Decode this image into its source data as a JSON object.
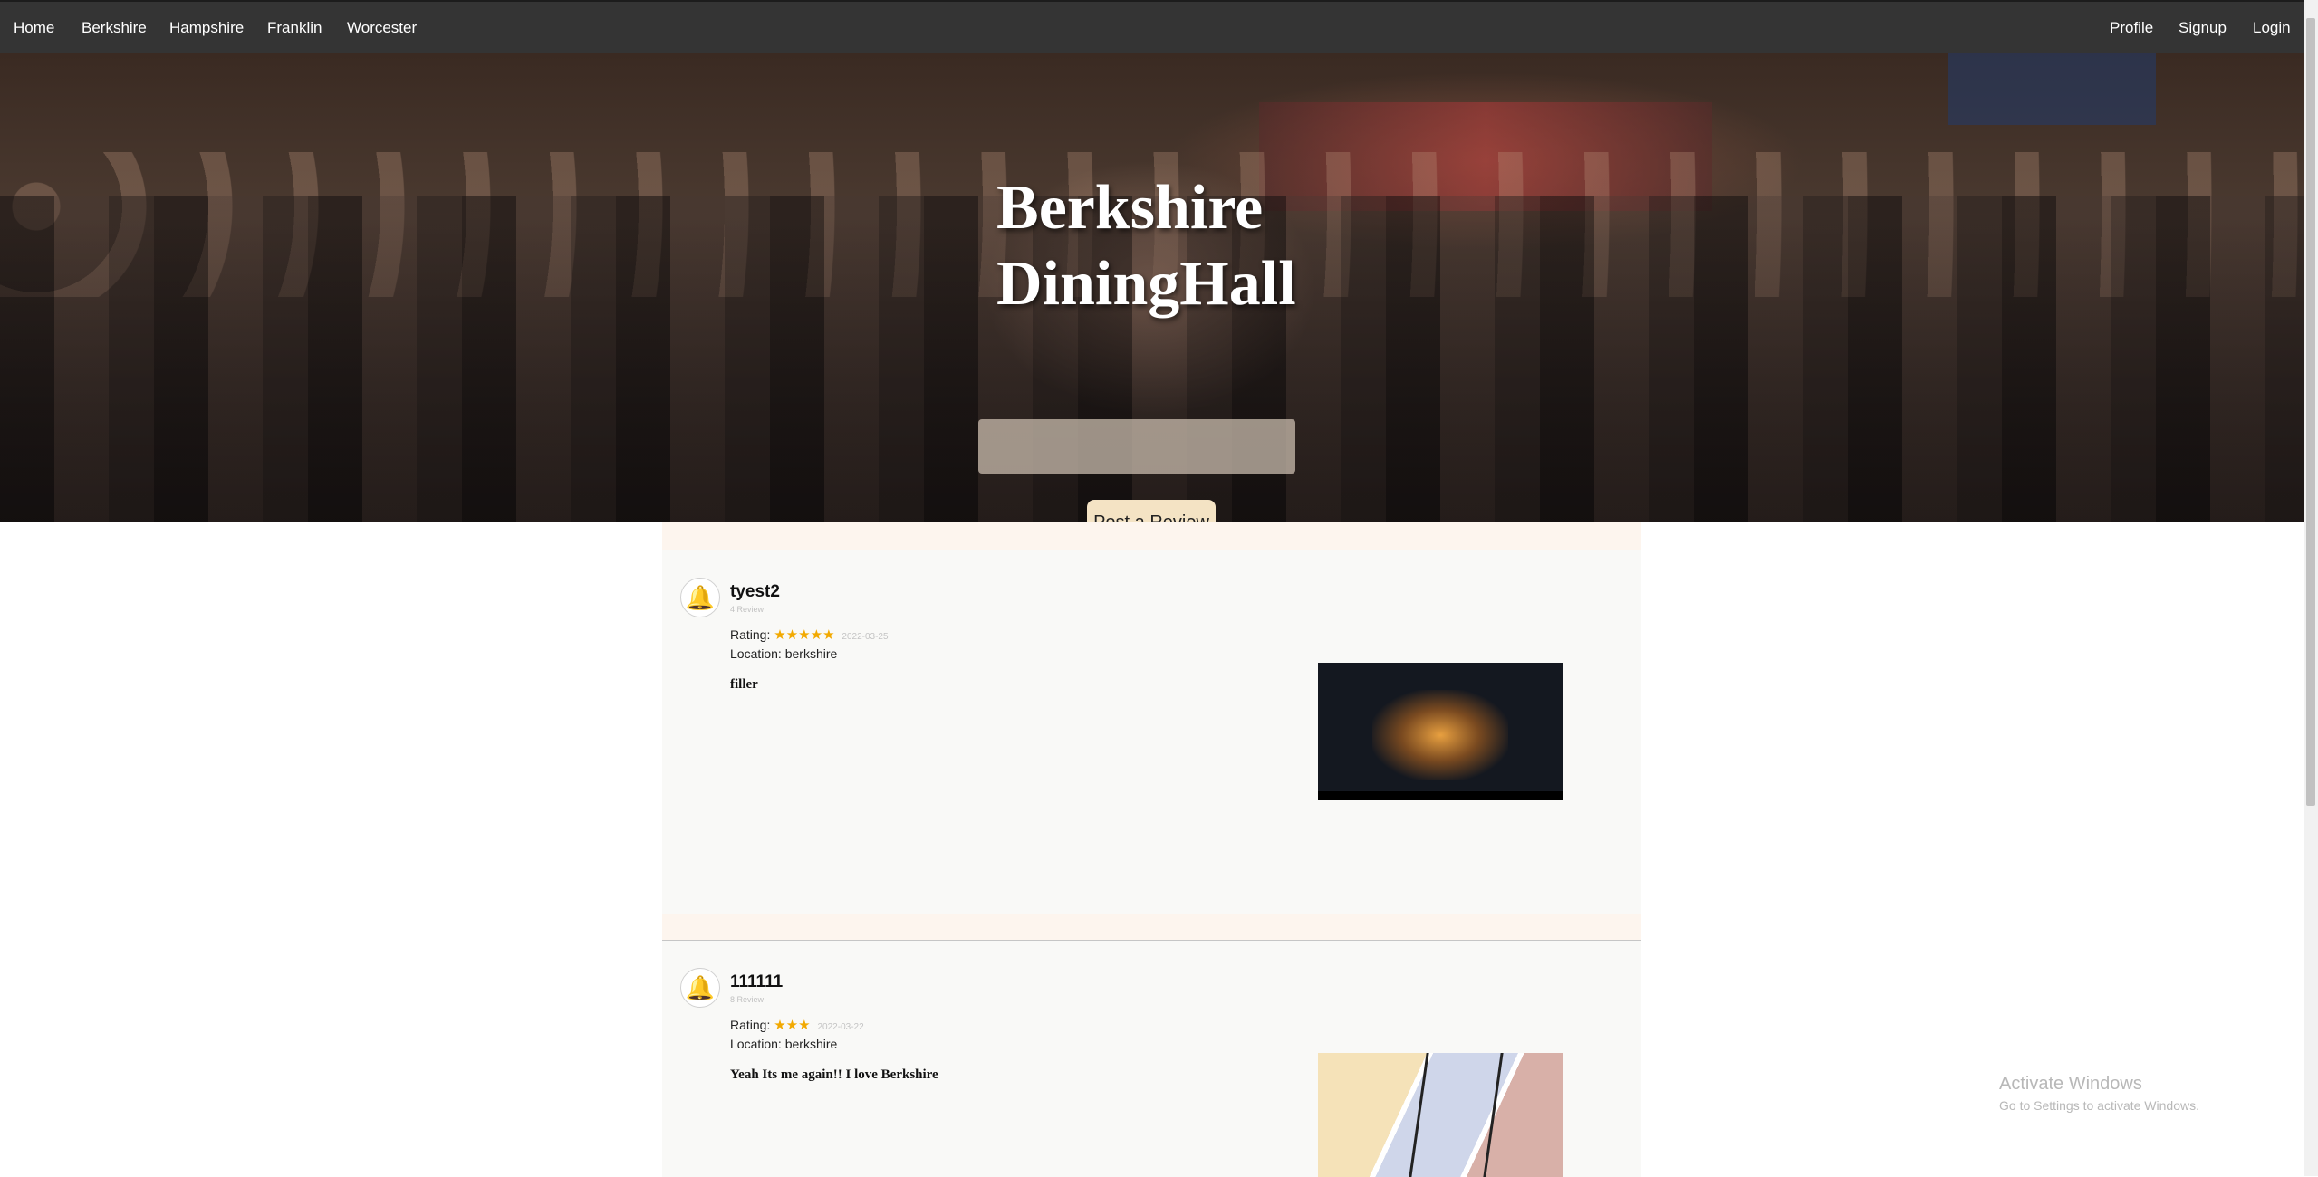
{
  "nav": {
    "left": [
      "Home",
      "Berkshire",
      "Hampshire",
      "Franklin",
      "Worcester"
    ],
    "right": [
      "Profile",
      "Signup",
      "Login"
    ]
  },
  "hero": {
    "title_line1": "Berkshire",
    "title_line2": "DiningHall",
    "post_button": "Post a Review"
  },
  "reviews": [
    {
      "username": "tyest2",
      "count": "4 Review",
      "rating_label": "Rating:",
      "stars": 5,
      "date": "2022-03-25",
      "location": "Location: berkshire",
      "text": "filler"
    },
    {
      "username": "111111",
      "count": "8 Review",
      "rating_label": "Rating:",
      "stars": 3,
      "date": "2022-03-22",
      "location": "Location: berkshire",
      "text": "Yeah Its me again!! I love Berkshire"
    }
  ],
  "watermark": {
    "line1": "Activate Windows",
    "line2": "Go to Settings to activate Windows."
  },
  "colors": {
    "nav_bg": "#343434",
    "star": "#f2a900",
    "button_bg": "#f4e3c4"
  }
}
